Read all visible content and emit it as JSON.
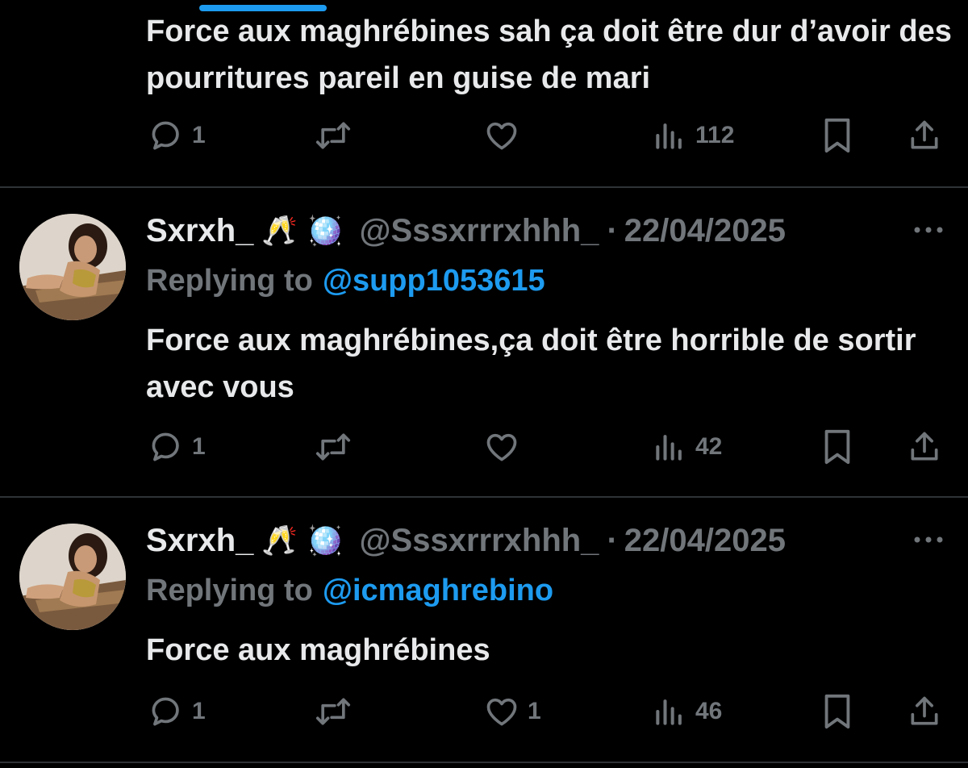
{
  "colors": {
    "background": "#000000",
    "text": "#e7e9ea",
    "secondary": "#71767b",
    "accent": "#1d9bf0",
    "divider": "#2f3336"
  },
  "tweets": [
    {
      "body": "Force aux maghrébines sah ça doit être dur d’avoir des pourritures pareil en guise de mari",
      "replies": "1",
      "reposts": "",
      "likes": "",
      "views": "112"
    },
    {
      "author": {
        "name": "Sxrxh_",
        "emoji": "🥂 🪩",
        "handle": "@Sssxrrrxhhh_",
        "date": "22/04/2025",
        "avatar": "profile-photo"
      },
      "replying_prefix": "Replying to",
      "replying_to": "@supp1053615",
      "body": "Force aux maghrébines,ça doit être horrible de sortir avec vous",
      "replies": "1",
      "reposts": "",
      "likes": "",
      "views": "42"
    },
    {
      "author": {
        "name": "Sxrxh_",
        "emoji": "🥂 🪩",
        "handle": "@Sssxrrrxhhh_",
        "date": "22/04/2025",
        "avatar": "profile-photo"
      },
      "replying_prefix": "Replying to",
      "replying_to": "@icmaghrebino",
      "body": "Force aux maghrébines",
      "replies": "1",
      "reposts": "",
      "likes": "1",
      "views": "46"
    }
  ],
  "icons": [
    "reply-icon",
    "repost-icon",
    "like-icon",
    "views-icon",
    "bookmark-icon",
    "share-icon",
    "more-icon"
  ]
}
